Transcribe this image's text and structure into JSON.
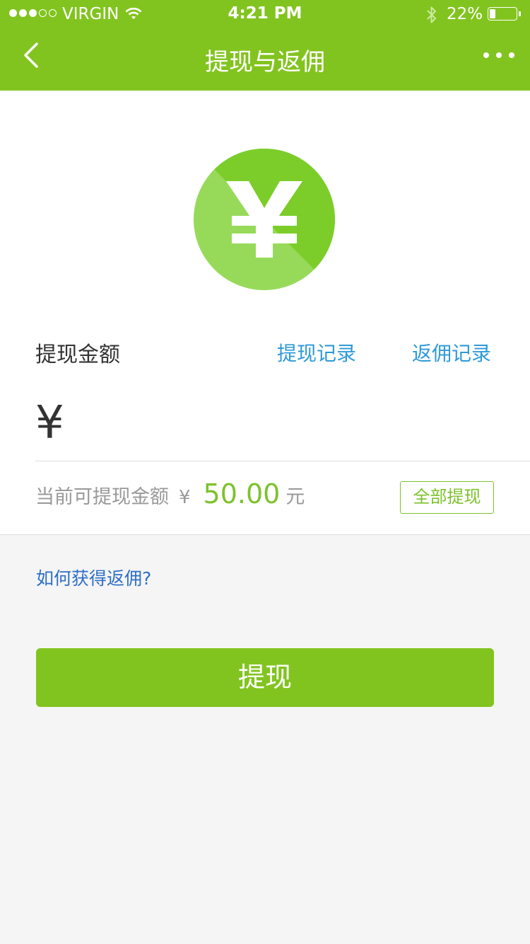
{
  "status_bar": {
    "carrier": "VIRGIN",
    "time": "4:21 PM",
    "battery": "22%",
    "battery_level": 0.22,
    "signal_bars_filled": 3,
    "signal_bars_total": 5
  },
  "nav": {
    "title": "提现与返佣",
    "back_icon": "chevron-left-icon",
    "more_icon": "more-dots-icon"
  },
  "hero": {
    "icon": "yen-coin-icon",
    "colors": {
      "dark": "#7ccd2a",
      "light": "#97da5a"
    }
  },
  "form": {
    "amount_label": "提现金额",
    "links": {
      "withdraw_record": "提现记录",
      "commission_record": "返佣记录"
    },
    "currency_symbol": "¥",
    "amount_value": "",
    "available": {
      "label": "当前可提现金额",
      "currency": "¥",
      "value": "50.00",
      "unit": "元"
    },
    "withdraw_all": "全部提现"
  },
  "help_link": "如何获得返佣?",
  "submit_label": "提现",
  "colors": {
    "brand_green": "#82c41f",
    "link_blue": "#2e9ad8",
    "amount_green": "#7cc22c"
  }
}
